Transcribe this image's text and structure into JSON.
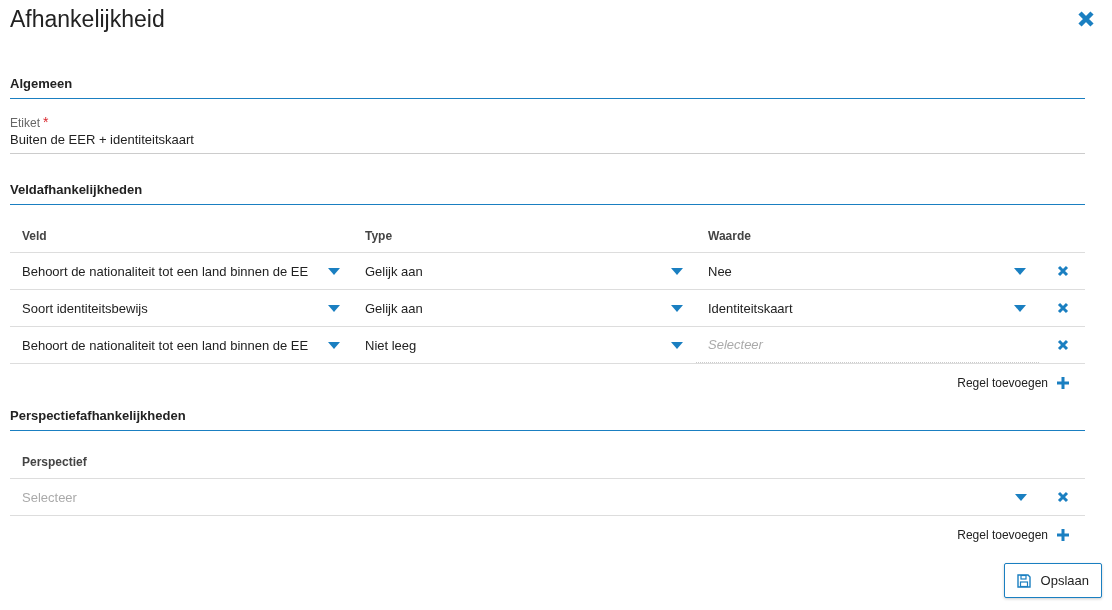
{
  "dialog": {
    "title": "Afhankelijkheid"
  },
  "general": {
    "heading": "Algemeen",
    "field": {
      "label": "Etiket",
      "required_mark": "*",
      "value": "Buiten de EER + identiteitskaart"
    }
  },
  "field_dependencies": {
    "heading": "Veldafhankelijkheden",
    "columns": [
      "Veld",
      "Type",
      "Waarde"
    ],
    "rows": [
      {
        "veld": {
          "value": "Behoort de nationaliteit tot een land binnen de EE"
        },
        "type": {
          "value": "Gelijk aan"
        },
        "waarde": {
          "value": "Nee"
        }
      },
      {
        "veld": {
          "value": "Soort identiteitsbewijs"
        },
        "type": {
          "value": "Gelijk aan"
        },
        "waarde": {
          "value": "Identiteitskaart"
        }
      },
      {
        "veld": {
          "value": "Behoort de nationaliteit tot een land binnen de EE"
        },
        "type": {
          "value": "Niet leeg"
        },
        "waarde": {
          "placeholder": "Selecteer"
        }
      }
    ],
    "add_label": "Regel toevoegen"
  },
  "perspective_dependencies": {
    "heading": "Perspectiefafhankelijkheden",
    "columns": [
      "Perspectief"
    ],
    "rows": [
      {
        "perspectief": {
          "placeholder": "Selecteer"
        }
      }
    ],
    "add_label": "Regel toevoegen"
  },
  "save_button": "Opslaan"
}
